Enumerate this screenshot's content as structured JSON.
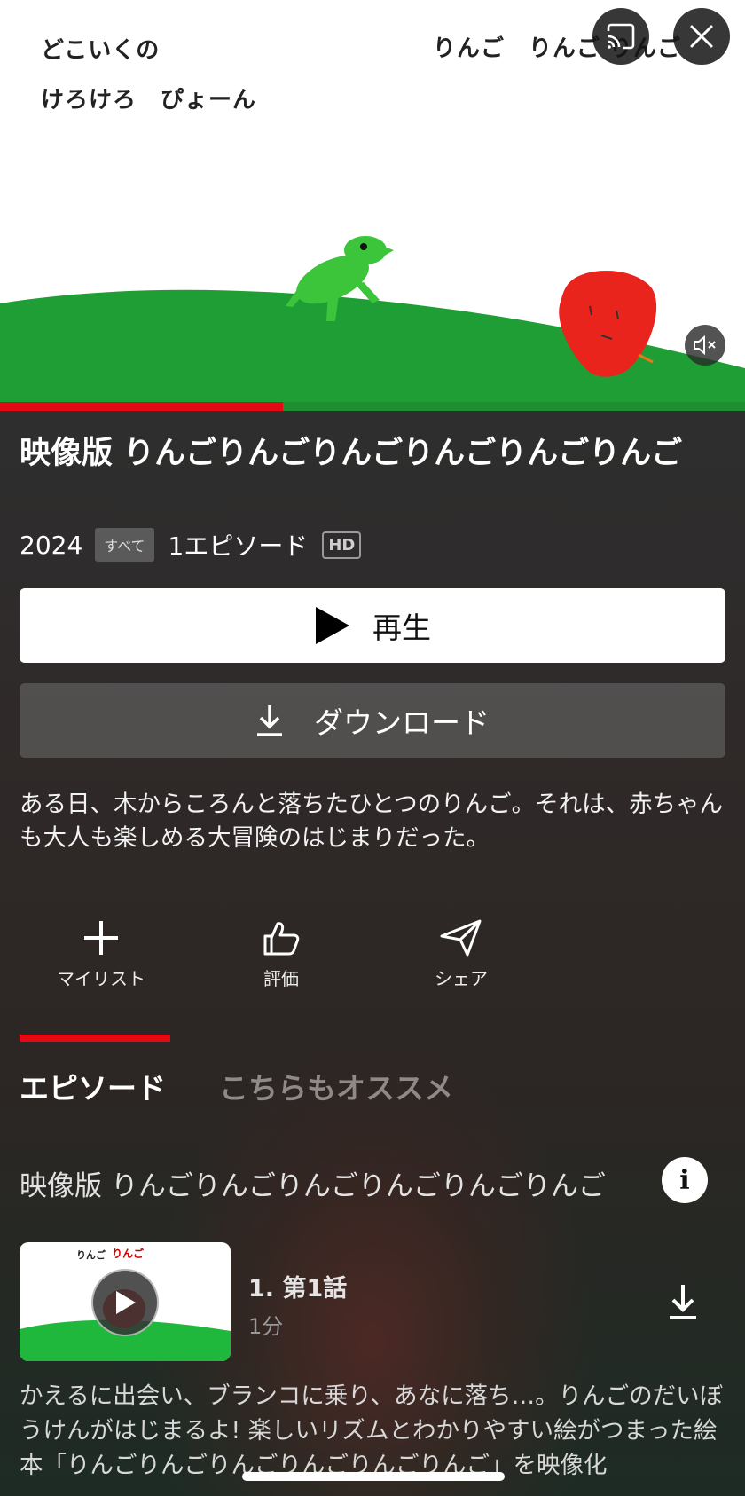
{
  "video": {
    "lyrics": [
      "どこいくの",
      "けろけろ　ぴょーん",
      "りんご　りんご りんご"
    ],
    "progress_percent": 38
  },
  "title": "映像版 りんごりんごりんごりんごりんごりんご",
  "meta": {
    "year": "2024",
    "rating": "すべて",
    "episodes": "1エピソード",
    "quality": "HD"
  },
  "buttons": {
    "play": "再生",
    "download": "ダウンロード"
  },
  "description": "ある日、木からころんと落ちたひとつのりんご。それは、赤ちゃんも大人も楽しめる大冒険のはじまりだった。",
  "actions": {
    "mylist": "マイリスト",
    "rate": "評価",
    "share": "シェア"
  },
  "tabs": {
    "episodes": "エピソード",
    "recommend": "こちらもオススメ"
  },
  "season_title": "映像版 りんごりんごりんごりんごりんごりんご",
  "info_label": "i",
  "episode": {
    "thumb_text_1": "りんご",
    "thumb_text_2": "りんご",
    "title": "1. 第1話",
    "duration": "1分",
    "description": "かえるに出会い、ブランコに乗り、あなに落ち…。りんごのだいぼうけんがはじまるよ! 楽しいリズムとわかりやすい絵がつまった絵本「りんごりんごりんごりんごりんごりんご」を映像化"
  },
  "colors": {
    "accent": "#e50914",
    "grass": "#1f9e36",
    "frog": "#3cc43a",
    "apple": "#e8241c"
  },
  "icons": [
    "cast-icon",
    "close-icon",
    "mute-icon",
    "play-icon",
    "download-icon",
    "plus-icon",
    "thumbs-up-icon",
    "send-icon",
    "info-icon"
  ]
}
